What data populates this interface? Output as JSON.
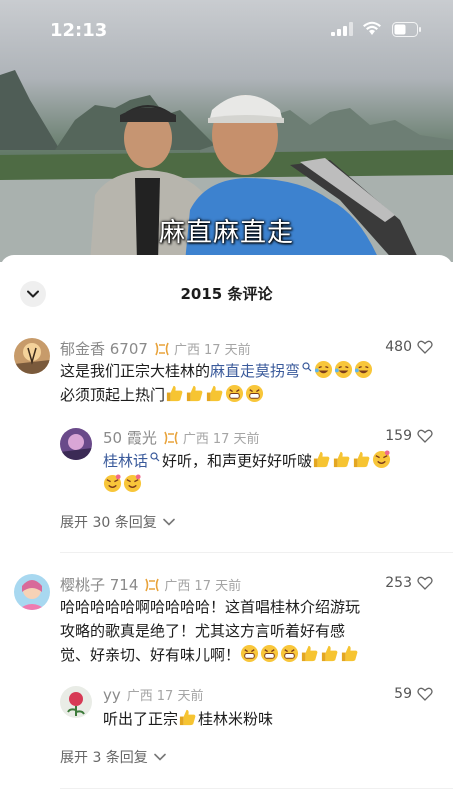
{
  "status_bar": {
    "time": "12:13"
  },
  "video": {
    "subtitle": "麻直麻直走"
  },
  "sheet": {
    "title": "2015 条评论"
  },
  "comments": [
    {
      "user": "郁金香 6707",
      "location": "广西",
      "time_ago": "17 天前",
      "likes": "480",
      "text_before_link": "这是我们正宗大桂林的",
      "link": "麻直走莫拐弯",
      "line2": "必须顶起上热门",
      "reply": {
        "user": "50 霞光",
        "location": "广西",
        "time_ago": "17 天前",
        "likes": "159",
        "link": "桂林话",
        "text": "好听，和声更好好听啵"
      },
      "expand_label": "展开 30 条回复"
    },
    {
      "user": "樱桃子 714",
      "location": "广西",
      "time_ago": "17 天前",
      "likes": "253",
      "line1": "哈哈哈哈哈啊哈哈哈哈！这首唱桂林介绍游玩",
      "line2": "攻略的歌真是绝了！尤其这方言听着好有感",
      "line3": "觉、好亲切、好有味儿啊！",
      "reply": {
        "user": "yy",
        "location": "广西",
        "time_ago": "17 天前",
        "likes": "59",
        "text_before": "听出了正宗",
        "text_after": "桂林米粉味"
      },
      "expand_label": "展开 3 条回复"
    }
  ],
  "colors": {
    "link": "#3a5a9b",
    "badge": "#e8a33c",
    "meta": "#8a8a8a"
  },
  "icons": [
    "signal-icon",
    "wifi-icon",
    "battery-icon",
    "chevron-down-icon",
    "heart-icon",
    "search-icon",
    "fan-badge-icon",
    "thumbs-up-emoji",
    "laughing-emoji",
    "grin-emoji",
    "love-emoji"
  ]
}
